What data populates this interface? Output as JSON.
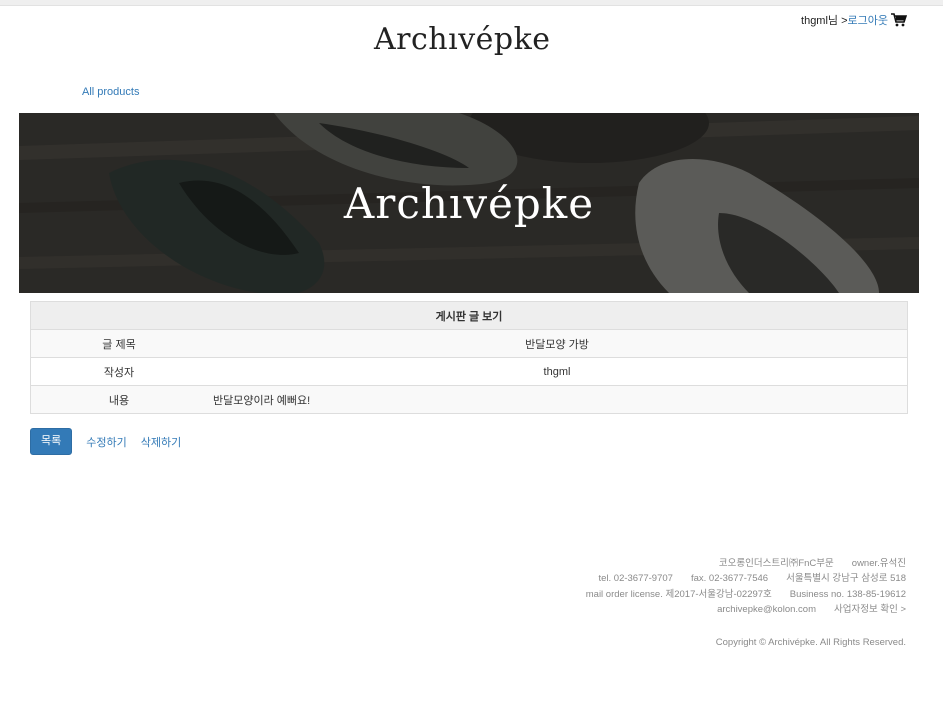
{
  "header": {
    "logo": "Archıvépke",
    "username": "thgml님 >",
    "logout_label": "로그아웃",
    "cart_icon": "cart-icon"
  },
  "nav": {
    "all_products": "All products"
  },
  "banner": {
    "title": "Archıvépke"
  },
  "board": {
    "heading": "게시판 글 보기",
    "title_label": "글 제목",
    "title_value": "반달모양 가방",
    "author_label": "작성자",
    "author_value": "thgml",
    "content_label": "내용",
    "content_value": "반달모양이라 예뻐요!"
  },
  "actions": {
    "list_label": "목록",
    "edit_label": "수정하기",
    "delete_label": "삭제하기"
  },
  "footer": {
    "company": "코오롱인더스트리㈜FnC부문",
    "owner": "owner.유석진",
    "tel": "tel. 02-3677-9707",
    "fax": "fax. 02-3677-7546",
    "address": "서울특별시 강남구 삼성로 518",
    "mail_order": "mail order license. 제2017-서울강남-02297호",
    "business": "Business no. 138-85-19612",
    "email": "archivepke@kolon.com",
    "biz_info": "사업자정보 확인 >",
    "copyright": "Copyright © Archivépke. All Rights Reserved."
  }
}
